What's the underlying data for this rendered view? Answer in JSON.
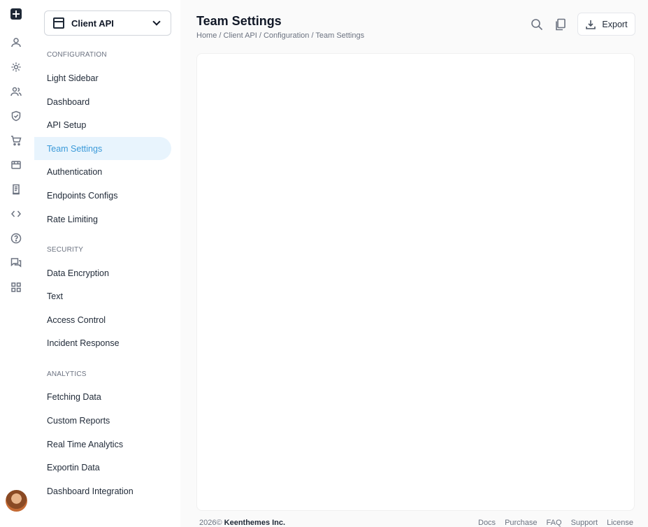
{
  "project": {
    "name": "Client API"
  },
  "sections": [
    {
      "title": "CONFIGURATION",
      "items": [
        "Light Sidebar",
        "Dashboard",
        "API Setup",
        "Team Settings",
        "Authentication",
        "Endpoints Configs",
        "Rate Limiting"
      ]
    },
    {
      "title": "SECURITY",
      "items": [
        "Data Encryption",
        "Text",
        "Access Control",
        "Incident Response"
      ]
    },
    {
      "title": "ANALYTICS",
      "items": [
        "Fetching Data",
        "Custom Reports",
        "Real Time Analytics",
        "Exportin Data",
        "Dashboard Integration"
      ]
    }
  ],
  "active_item": "Team Settings",
  "rail_icons": [
    "user-icon",
    "gear-icon",
    "users-icon",
    "shield-icon",
    "cart-icon",
    "store-icon",
    "document-icon",
    "code-icon",
    "help-icon",
    "chat-icon",
    "apps-icon"
  ],
  "header": {
    "title": "Team Settings",
    "breadcrumb": "Home / Client API / Configuration / Team Settings",
    "export_label": "Export"
  },
  "footer": {
    "year": "2026©",
    "company": "Keenthemes Inc.",
    "links": [
      "Docs",
      "Purchase",
      "FAQ",
      "Support",
      "License"
    ]
  },
  "colors": {
    "accent": "#3b9ad9",
    "active_bg": "#e8f4fd"
  }
}
